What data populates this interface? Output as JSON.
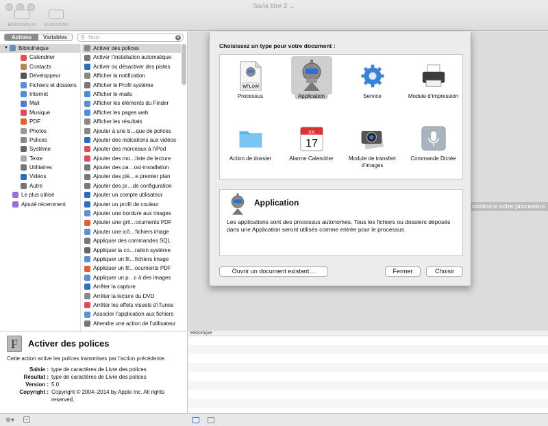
{
  "window": {
    "title": "Sans titre 2"
  },
  "toolbar": {
    "library_label": "Bibliothèque",
    "media_label": "Multimédia"
  },
  "sidebar": {
    "tab_actions": "Actions",
    "tab_variables": "Variables",
    "search_placeholder": "Nom",
    "library_root": "Bibliothèque",
    "categories": [
      {
        "label": "Calendrier",
        "color": "#d9534f"
      },
      {
        "label": "Contacts",
        "color": "#b5885a"
      },
      {
        "label": "Développeur",
        "color": "#555"
      },
      {
        "label": "Fichiers et dossiers",
        "color": "#5b8fd6"
      },
      {
        "label": "Internet",
        "color": "#4a90d9"
      },
      {
        "label": "Mail",
        "color": "#4a7fd6"
      },
      {
        "label": "Musique",
        "color": "#e04a5a"
      },
      {
        "label": "PDF",
        "color": "#e06030"
      },
      {
        "label": "Photos",
        "color": "#999"
      },
      {
        "label": "Polices",
        "color": "#888"
      },
      {
        "label": "Système",
        "color": "#666"
      },
      {
        "label": "Texte",
        "color": "#aaa"
      },
      {
        "label": "Utilitaires",
        "color": "#777"
      },
      {
        "label": "Vidéos",
        "color": "#2a6fbf"
      },
      {
        "label": "Autre",
        "color": "#777"
      }
    ],
    "extras": [
      {
        "label": "Le plus utilisé",
        "color": "#9a6fd6"
      },
      {
        "label": "Ajouté récemment",
        "color": "#9a6fd6"
      }
    ]
  },
  "actions": [
    "Activer des polices",
    "Activer l’installation automatique",
    "Activer ou désactiver des pistes",
    "Afficher la notification",
    "Afficher le Profil système",
    "Afficher le-mails",
    "Afficher les éléments du Finder",
    "Afficher les pages web",
    "Afficher les résultats",
    "Ajouter à une b…que de polices",
    "Ajouter des indications aux vidéos",
    "Ajouter des morceaux à l’iPod",
    "Ajouter des mo…liste de lecture",
    "Ajouter des pa…ost-installation",
    "Ajouter des piè…e premier plan",
    "Ajouter des pr…de configuration",
    "Ajouter un compte utilisateur",
    "Ajouter un profil de couleur",
    "Ajouter une bordure aux images",
    "Ajouter une gril…ocuments PDF",
    "Ajouter une icô…fichiers image",
    "Appliquer des commandes SQL",
    "Appliquer la co…ration système",
    "Appliquer un fil…fichiers image",
    "Appliquer un fil…ocuments PDF",
    "Appliquer un p…c à des images",
    "Arrêter la capture",
    "Arrêter la lecture du DVD",
    "Arrêter les effets visuels d’iTunes",
    "Associer l’application aux fichiers",
    "Attendre une action de l’utilisateur"
  ],
  "action_icon_colors": [
    "#888",
    "#777",
    "#2a6fbf",
    "#888",
    "#777",
    "#4a90d9",
    "#5b8fd6",
    "#4a90d9",
    "#888",
    "#888",
    "#2a6fbf",
    "#e04a5a",
    "#e04a5a",
    "#777",
    "#777",
    "#777",
    "#2a6fbf",
    "#2a6fbf",
    "#5b8fd6",
    "#e06030",
    "#5b8fd6",
    "#777",
    "#666",
    "#5b8fd6",
    "#e06030",
    "#5b8fd6",
    "#2a6fbf",
    "#888",
    "#e04a5a",
    "#5b8fd6",
    "#777"
  ],
  "description": {
    "icon_letter": "F",
    "title": "Activer des polices",
    "summary": "Cette action active les polices transmises par l’action précédente.",
    "rows": [
      {
        "k": "Saisie :",
        "v": "type de caractères de Livre des polices"
      },
      {
        "k": "Résultat :",
        "v": "type de caractères de Livre des polices"
      },
      {
        "k": "Version :",
        "v": "5.0"
      },
      {
        "k": "Copyright :",
        "v": "Copyright © 2004–2014 by Apple Inc. All rights reserved."
      }
    ]
  },
  "workflow": {
    "hint": "onstruire votre processus.",
    "history_label": "Historique"
  },
  "sheet": {
    "header": "Choisissez un type pour votre document :",
    "types": [
      {
        "label": "Processus",
        "icon": "wflow-document-icon",
        "badge": "WFLOW"
      },
      {
        "label": "Application",
        "icon": "automator-robot-icon"
      },
      {
        "label": "Service",
        "icon": "gear-icon"
      },
      {
        "label": "Module d’impression",
        "icon": "printer-icon"
      },
      {
        "label": "Action de dossier",
        "icon": "folder-icon"
      },
      {
        "label": "Alarme Calendrier",
        "icon": "calendar-icon",
        "month": "JUL",
        "day": "17"
      },
      {
        "label": "Module de transfert d’images",
        "icon": "camera-icon"
      },
      {
        "label": "Commande Dictée",
        "icon": "microphone-icon"
      }
    ],
    "selected_title": "Application",
    "selected_description": "Les applications sont des processus autonomes. Tous les fichiers ou dossiers déposés dans une Application seront utilisés comme entrée pour le processus.",
    "btn_open": "Ouvrir un document existant…",
    "btn_close": "Fermer",
    "btn_choose": "Choisir"
  }
}
